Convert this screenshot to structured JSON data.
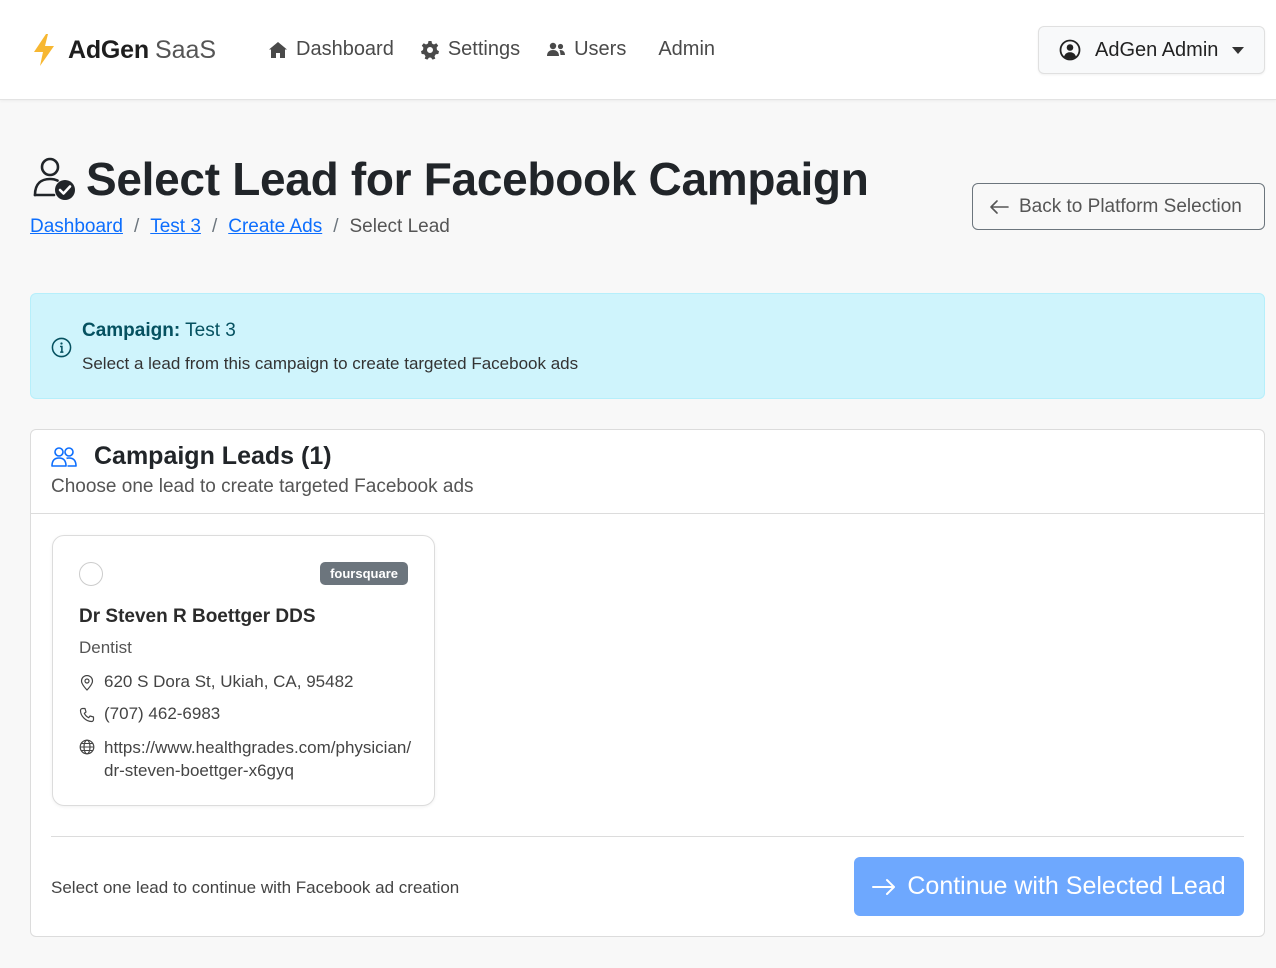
{
  "navbar": {
    "brand_name": "AdGen",
    "brand_suffix": "SaaS",
    "links": [
      {
        "label": "Dashboard",
        "icon": "house-icon"
      },
      {
        "label": "Settings",
        "icon": "gear-icon"
      },
      {
        "label": "Users",
        "icon": "users-icon"
      },
      {
        "label": "Admin"
      }
    ],
    "user": {
      "name": "AdGen Admin",
      "icon": "user-circle-icon"
    }
  },
  "header": {
    "title": "Select Lead for Facebook Campaign",
    "icon": "person-check-icon",
    "breadcrumb": [
      {
        "label": "Dashboard",
        "link": true
      },
      {
        "label": "Test 3",
        "link": true
      },
      {
        "label": "Create Ads",
        "link": true
      },
      {
        "label": "Select Lead",
        "link": false
      }
    ],
    "back_button": "Back to Platform Selection"
  },
  "alert": {
    "title_label": "Campaign:",
    "title_value": "Test 3",
    "message": "Select a lead from this campaign to create targeted Facebook ads",
    "icon": "info-circle-icon"
  },
  "leads_card": {
    "title": "Campaign Leads (1)",
    "subtitle": "Choose one lead to create targeted Facebook ads",
    "leads": [
      {
        "name": "Dr Steven R Boettger DDS",
        "type": "Dentist",
        "source": "foursquare",
        "address": "620 S Dora St, Ukiah, CA, 95482",
        "phone": "(707) 462-6983",
        "website": "https://www.healthgrades.com/physician/dr-steven-boettger-x6gyq",
        "selected": false
      }
    ],
    "footer_text": "Select one lead to continue with Facebook ad creation",
    "continue_button": "Continue with Selected Lead"
  },
  "colors": {
    "primary": "#0d6efd",
    "primary_disabled": "#6ea8fe",
    "alert_bg": "#cff4fc",
    "alert_text": "#055160",
    "bolt": "#f7b731",
    "badge": "#6c757d"
  }
}
